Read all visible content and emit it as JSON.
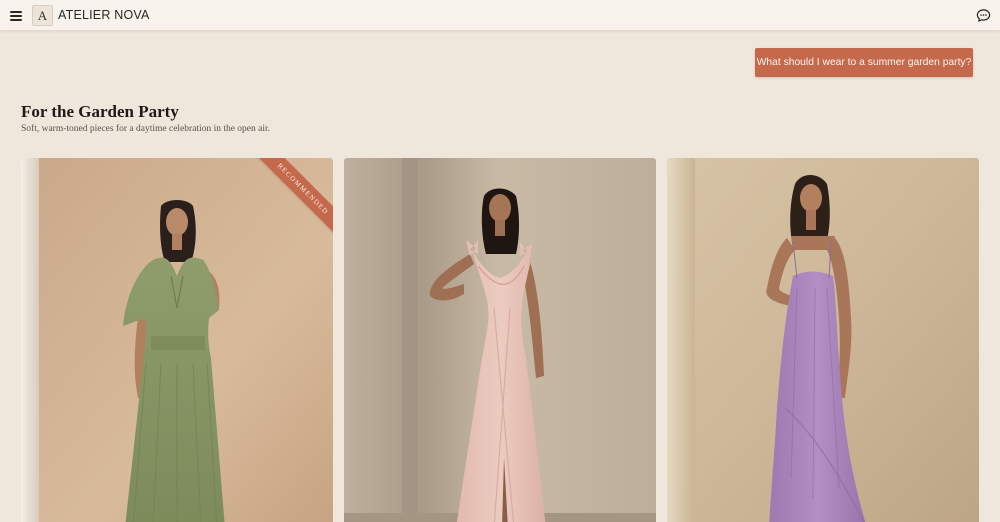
{
  "header": {
    "brand_mark": "A",
    "brand_name": "ATELIER NOVA",
    "menu_icon": "hamburger-menu-icon",
    "chat_icon": "chat-bubble-icon"
  },
  "chat": {
    "user_query": "What should I wear to a summer garden party?"
  },
  "section": {
    "title": "For the Garden Party",
    "subtitle": "Soft, warm-toned pieces for a daytime celebration in the open air."
  },
  "products": [
    {
      "badge": "RECOMMENDED",
      "dress_color": "#8c9a6a",
      "description": "sage green flutter-sleeve chiffon maxi dress"
    },
    {
      "badge": "",
      "dress_color": "#e8c2b8",
      "description": "blush pink tie-shoulder textured wrap maxi dress"
    },
    {
      "badge": "",
      "dress_color": "#a27fb6",
      "description": "lavender scoop-neck slip dress with asymmetric hem"
    }
  ],
  "colors": {
    "background": "#efe6dc",
    "topbar": "#f7f3ec",
    "accent": "#c4694c"
  }
}
